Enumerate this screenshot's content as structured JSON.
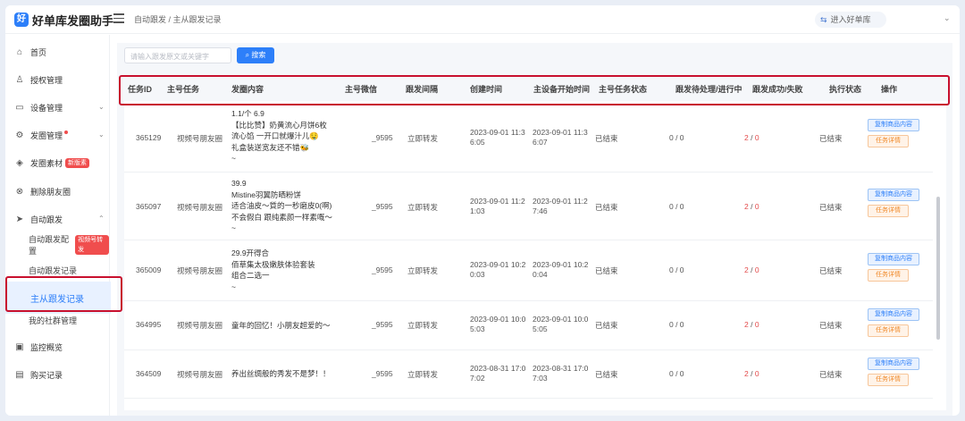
{
  "app": {
    "title": "好单库发圈助手",
    "logo": "好"
  },
  "breadcrumb": "自动跟发 / 主从跟发记录",
  "account": {
    "label": "进入好单库"
  },
  "sidebar": {
    "items": [
      {
        "label": "首页",
        "icon": "home-icon"
      },
      {
        "label": "授权管理",
        "icon": "user-icon"
      },
      {
        "label": "设备管理",
        "icon": "device-icon"
      },
      {
        "label": "发圈管理",
        "icon": "gear-icon"
      },
      {
        "label": "发圈素材",
        "icon": "cube-icon",
        "tag": "新版素"
      },
      {
        "label": "删除朋友圈",
        "icon": "delete-icon"
      },
      {
        "label": "自动跟发",
        "icon": "send-icon"
      },
      {
        "label": "自动跟发配置",
        "tag": "视频号转发"
      },
      {
        "label": "自动跟发记录"
      },
      {
        "label": "主从跟发记录"
      },
      {
        "label": "我的社群管理"
      },
      {
        "label": "监控概览",
        "icon": "monitor-icon"
      },
      {
        "label": "购买记录",
        "icon": "receipt-icon"
      }
    ]
  },
  "search": {
    "placeholder": "请输入跟发原文或关键字",
    "button": "搜索"
  },
  "table": {
    "headers": [
      "任务ID",
      "主号任务",
      "发圈内容",
      "主号微信",
      "跟发间隔",
      "创建时间",
      "主设备开始时间",
      "主号任务状态",
      "跟发待处理/进行中",
      "跟发成功/失败",
      "执行状态",
      "操作"
    ],
    "actions": {
      "copy": "复制商品内容",
      "detail": "任务详情"
    },
    "rows": [
      {
        "id": "365129",
        "task": "视频号朋友圈",
        "content": [
          "1.1/个 6.9",
          "【比比赞】奶黄流心月饼6枚",
          "流心馅 一开口就爆汁儿🤤",
          "礼盒装送宽友还不错🐝",
          "~"
        ],
        "wx": "_9595",
        "interval": "立即转发",
        "created": [
          "2023-09-01 11:3",
          "6:05"
        ],
        "start": [
          "2023-09-01 11:3",
          "6:07"
        ],
        "status": "已结束",
        "pending": "0 / 0",
        "succ": "2",
        "fail": "0",
        "exec": "已结束"
      },
      {
        "id": "365097",
        "task": "视频号朋友圈",
        "content": [
          "39.9",
          "Mistine羽翼防晒粉饼",
          "适合油皮～質的一秒磨皮0(啊)",
          "不会假白 跟纯素颜一样素嘅～",
          "~"
        ],
        "wx": "_9595",
        "interval": "立即转发",
        "created": [
          "2023-09-01 11:2",
          "1:03"
        ],
        "start": [
          "2023-09-01 11:2",
          "7:46"
        ],
        "status": "已结束",
        "pending": "0 / 0",
        "succ": "2",
        "fail": "0",
        "exec": "已结束"
      },
      {
        "id": "365009",
        "task": "视频号朋友圈",
        "content": [
          "29.9开得合",
          "佰草集太极嫩肤体验套装",
          "组合二选一",
          "~"
        ],
        "wx": "_9595",
        "interval": "立即转发",
        "created": [
          "2023-09-01 10:2",
          "0:03"
        ],
        "start": [
          "2023-09-01 10:2",
          "0:04"
        ],
        "status": "已结束",
        "pending": "0 / 0",
        "succ": "2",
        "fail": "0",
        "exec": "已结束"
      },
      {
        "id": "364995",
        "task": "视频号朋友圈",
        "content": [
          "童年的回忆！小朋友超爱的～"
        ],
        "wx": "_9595",
        "interval": "立即转发",
        "created": [
          "2023-09-01 10:0",
          "5:03"
        ],
        "start": [
          "2023-09-01 10:0",
          "5:05"
        ],
        "status": "已结束",
        "pending": "0 / 0",
        "succ": "2",
        "fail": "0",
        "exec": "已结束"
      },
      {
        "id": "364509",
        "task": "视频号朋友圈",
        "content": [
          "养出丝绸般的秀发不是梦！！"
        ],
        "wx": "_9595",
        "interval": "立即转发",
        "created": [
          "2023-08-31 17:0",
          "7:02"
        ],
        "start": [
          "2023-08-31 17:0",
          "7:03"
        ],
        "status": "已结束",
        "pending": "0 / 0",
        "succ": "2",
        "fail": "0",
        "exec": "已结束"
      }
    ]
  }
}
